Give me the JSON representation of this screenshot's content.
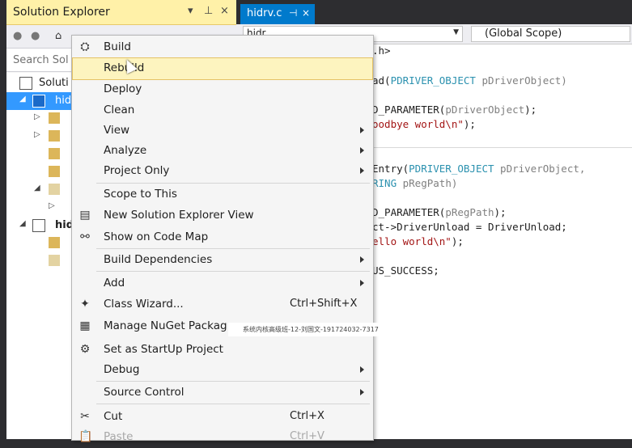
{
  "solution_explorer": {
    "title": "Solution Explorer",
    "pin_glyph": "▾ ⊥",
    "close_glyph": "×",
    "search_placeholder": "Search Sol",
    "tree": [
      {
        "label": "Soluti",
        "icon": "solution-icon"
      },
      {
        "label": "hid",
        "icon": "project-icon",
        "selected": true
      },
      {
        "label": "",
        "icon": "folder-icon"
      },
      {
        "label": "",
        "icon": "folder-icon"
      },
      {
        "label": "",
        "icon": "folder-icon"
      },
      {
        "label": "",
        "icon": "folder-icon"
      },
      {
        "label": "",
        "icon": "folder-icon"
      },
      {
        "label": "",
        "icon": "folder-icon"
      },
      {
        "label": "hid",
        "icon": "project-icon"
      },
      {
        "label": "",
        "icon": "folder-icon"
      },
      {
        "label": "",
        "icon": "folder-icon"
      }
    ]
  },
  "editor": {
    "tab_label": "hidrv.c",
    "tab_pin": "⊣",
    "tab_close": "×",
    "nav_left_value": "hidr",
    "nav_right_value": "(Global Scope)",
    "code": {
      "line1": ".h>",
      "line2a": "ad(",
      "line2b": "PDRIVER_OBJECT",
      "line2c": " pDriverObject)",
      "line3a": "D_PARAMETER(",
      "line3b": "pDriverObject",
      "line3c": ");",
      "line4a": "oodbye world\\n\"",
      "line4b": ");",
      "line5a": "Entry(",
      "line5b": "PDRIVER_OBJECT",
      "line5c": " pDriverObject,",
      "line6a": "RING",
      "line6b": " pRegPath)",
      "line7a": "D_PARAMETER(",
      "line7b": "pRegPath",
      "line7c": ");",
      "line8": "ct->DriverUnload = DriverUnload;",
      "line9a": "ello world\\n\"",
      "line9b": ");",
      "line10": "US_SUCCESS;"
    }
  },
  "context_menu": {
    "items": [
      {
        "label": "Build",
        "icon": "build-icon"
      },
      {
        "label": "Rebuild",
        "hover": true
      },
      {
        "label": "Deploy"
      },
      {
        "label": "Clean"
      },
      {
        "label": "View",
        "submenu": true
      },
      {
        "label": "Analyze",
        "submenu": true
      },
      {
        "label": "Project Only",
        "submenu": true
      },
      {
        "label": "Scope to This"
      },
      {
        "label": "New Solution Explorer View",
        "icon": "new-view-icon"
      },
      {
        "label": "Show on Code Map",
        "icon": "code-map-icon"
      },
      {
        "label": "Build Dependencies",
        "submenu": true
      },
      {
        "label": "Add",
        "submenu": true
      },
      {
        "label": "Class Wizard...",
        "shortcut": "Ctrl+Shift+X",
        "icon": "class-wizard-icon"
      },
      {
        "label": "Manage NuGet Packag",
        "icon": "nuget-icon"
      },
      {
        "label": "Set as StartUp Project",
        "icon": "gear-icon"
      },
      {
        "label": "Debug",
        "submenu": true
      },
      {
        "label": "Source Control",
        "submenu": true
      },
      {
        "label": "Cut",
        "shortcut": "Ctrl+X",
        "icon": "scissors-icon"
      },
      {
        "label": "Paste",
        "shortcut": "Ctrl+V",
        "icon": "paste-icon",
        "disabled": true
      }
    ]
  },
  "watermark": "系统内核高级班-12-刘国文-191724032-7317"
}
